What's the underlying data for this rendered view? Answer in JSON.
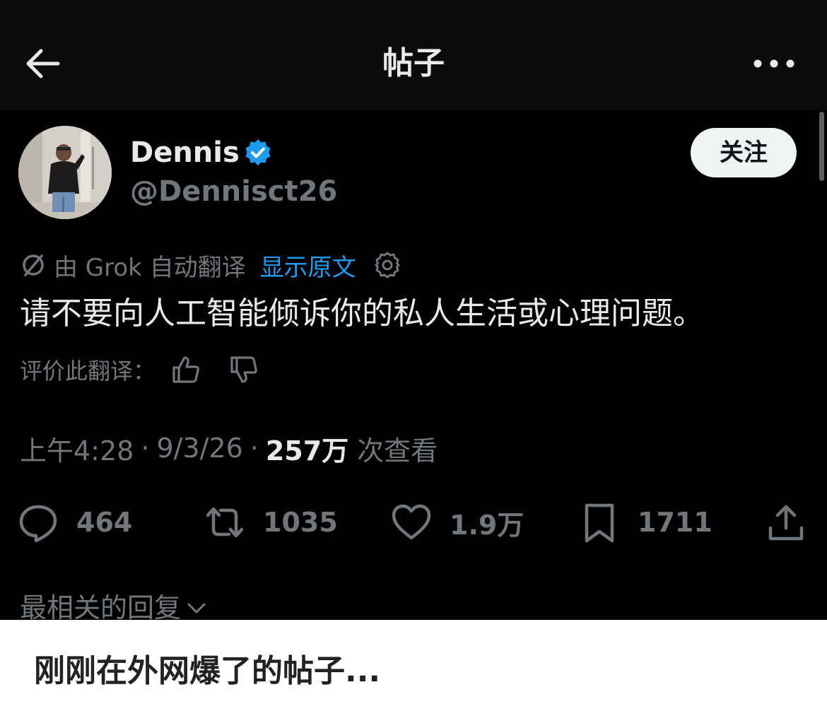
{
  "header": {
    "title": "帖子",
    "back_icon": "back-arrow-icon",
    "more_icon": "more-horizontal-icon"
  },
  "author": {
    "name": "Dennis",
    "handle": "@Dennisct26",
    "verified": true,
    "follow_label": "关注"
  },
  "translation": {
    "label": "由 Grok 自动翻译",
    "show_original": "显示原文",
    "rate_label": "评价此翻译："
  },
  "post": {
    "text": "请不要向人工智能倾诉你的私人生活或心理问题。",
    "time": "上午4:28",
    "date": "9/3/26",
    "views_count": "257万",
    "views_label": "次查看"
  },
  "actions": {
    "replies": "464",
    "reposts": "1035",
    "likes": "1.9万",
    "bookmarks": "1711"
  },
  "replies_sort": "最相关的回复",
  "caption": "刚刚在外网爆了的帖子...",
  "colors": {
    "background": "#000000",
    "text_primary": "#e7e9ea",
    "text_secondary": "#71767b",
    "accent": "#1d9bf0"
  }
}
